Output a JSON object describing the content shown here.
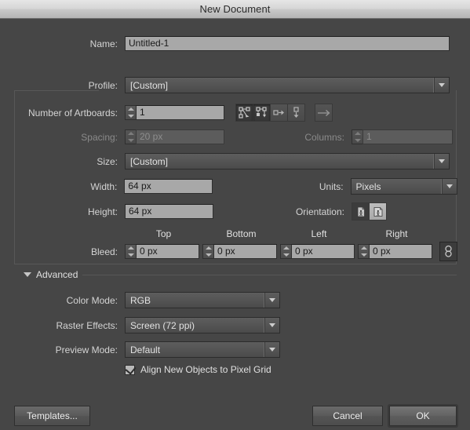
{
  "window": {
    "title": "New Document"
  },
  "fields": {
    "name_label": "Name:",
    "name_value": "Untitled-1",
    "profile_label": "Profile:",
    "profile_value": "[Custom]",
    "artboards_label": "Number of Artboards:",
    "artboards_value": "1",
    "spacing_label": "Spacing:",
    "spacing_value": "20 px",
    "columns_label": "Columns:",
    "columns_value": "1",
    "size_label": "Size:",
    "size_value": "[Custom]",
    "width_label": "Width:",
    "width_value": "64 px",
    "height_label": "Height:",
    "height_value": "64 px",
    "units_label": "Units:",
    "units_value": "Pixels",
    "orientation_label": "Orientation:"
  },
  "bleed": {
    "label": "Bleed:",
    "col_top": "Top",
    "col_bottom": "Bottom",
    "col_left": "Left",
    "col_right": "Right",
    "top_value": "0 px",
    "bottom_value": "0 px",
    "left_value": "0 px",
    "right_value": "0 px"
  },
  "advanced": {
    "title": "Advanced",
    "color_mode_label": "Color Mode:",
    "color_mode_value": "RGB",
    "raster_label": "Raster Effects:",
    "raster_value": "Screen (72 ppi)",
    "preview_label": "Preview Mode:",
    "preview_value": "Default",
    "align_grid_label": "Align New Objects to Pixel Grid",
    "align_grid_checked": true
  },
  "buttons": {
    "templates": "Templates...",
    "cancel": "Cancel",
    "ok": "OK"
  },
  "icons": {
    "arrange_grid_row": "grid-by-row-icon",
    "arrange_grid_column": "grid-by-column-icon",
    "arrange_row": "arrange-in-row-icon",
    "arrange_column": "arrange-in-column-icon",
    "flow_direction": "right-to-left-flow-icon",
    "orientation_portrait": "portrait-orientation-icon",
    "orientation_landscape": "landscape-orientation-icon",
    "bleed_link": "link-bleed-values-icon",
    "disclosure": "disclosure-triangle-icon"
  },
  "colors": {
    "dialog_bg": "#464646",
    "field_bg": "#a8a8a8",
    "text": "#d4d4d4",
    "disabled_text": "#8a8a8a",
    "frame": "#585858"
  }
}
